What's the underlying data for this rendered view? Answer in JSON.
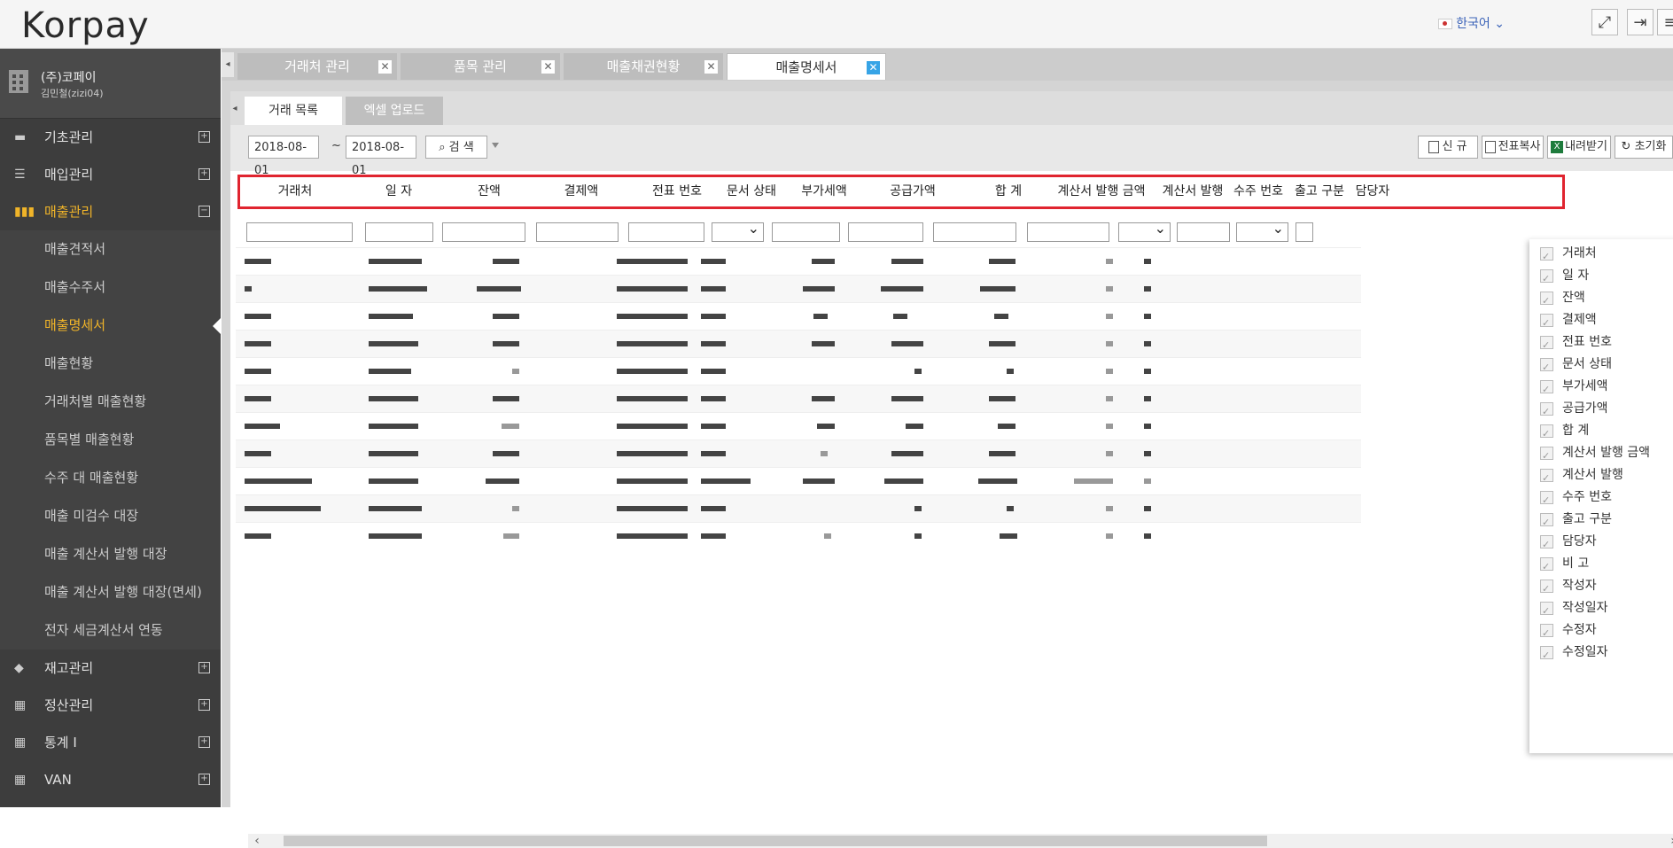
{
  "header": {
    "logo": "Korpay",
    "language": "한국어"
  },
  "sidebar": {
    "company": "(주)코페이",
    "user": "김민철(zizi04)",
    "menus": [
      {
        "label": "기초관리",
        "icon": "folder-icon"
      },
      {
        "label": "매입관리",
        "icon": "list-icon"
      },
      {
        "label": "매출관리",
        "icon": "bar-chart-icon"
      },
      {
        "label": "재고관리",
        "icon": "cubes-icon"
      },
      {
        "label": "정산관리",
        "icon": "calculator-icon"
      },
      {
        "label": "통계 I",
        "icon": "calculator-icon"
      },
      {
        "label": "VAN",
        "icon": "calculator-icon"
      }
    ],
    "sales_submenu": [
      "매출견적서",
      "매출수주서",
      "매출명세서",
      "매출현황",
      "거래처별 매출현황",
      "품목별 매출현황",
      "수주 대 매출현황",
      "매출 미검수 대장",
      "매출 계산서 발행 대장",
      "매출 계산서 발행 대장(면세)",
      "전자 세금계산서 연동"
    ]
  },
  "tabs": [
    "거래처 관리",
    "품목 관리",
    "매출채권현황",
    "매출명세서"
  ],
  "subtabs": [
    "거래 목록",
    "엑셀 업로드"
  ],
  "toolbar": {
    "date_from": "2018-08-01",
    "tilde": "~",
    "date_to": "2018-08-01",
    "search": "검 색",
    "new": "신 규",
    "copy": "전표복사",
    "excel": "내려받기",
    "reset": "초기화"
  },
  "columns": [
    "거래처",
    "일 자",
    "잔액",
    "결제액",
    "전표 번호",
    "문서 상태",
    "부가세액",
    "공급가액",
    "합 계",
    "계산서 발행 금액",
    "계산서 발행",
    "수주 번호",
    "출고 구분",
    "담당자"
  ],
  "column_chooser": [
    "거래처",
    "일 자",
    "잔액",
    "결제액",
    "전표 번호",
    "문서 상태",
    "부가세액",
    "공급가액",
    "합 계",
    "계산서 발행 금액",
    "계산서 발행",
    "수주 번호",
    "출고 구분",
    "담당자",
    "비 고",
    "작성자",
    "작성일자",
    "수정자",
    "수정일자"
  ],
  "colors": {
    "sidebar_bg": "#3d3d3d",
    "accent": "#f0b429",
    "highlight_border": "#e0242f",
    "active_tab_close": "#37a4e6"
  }
}
